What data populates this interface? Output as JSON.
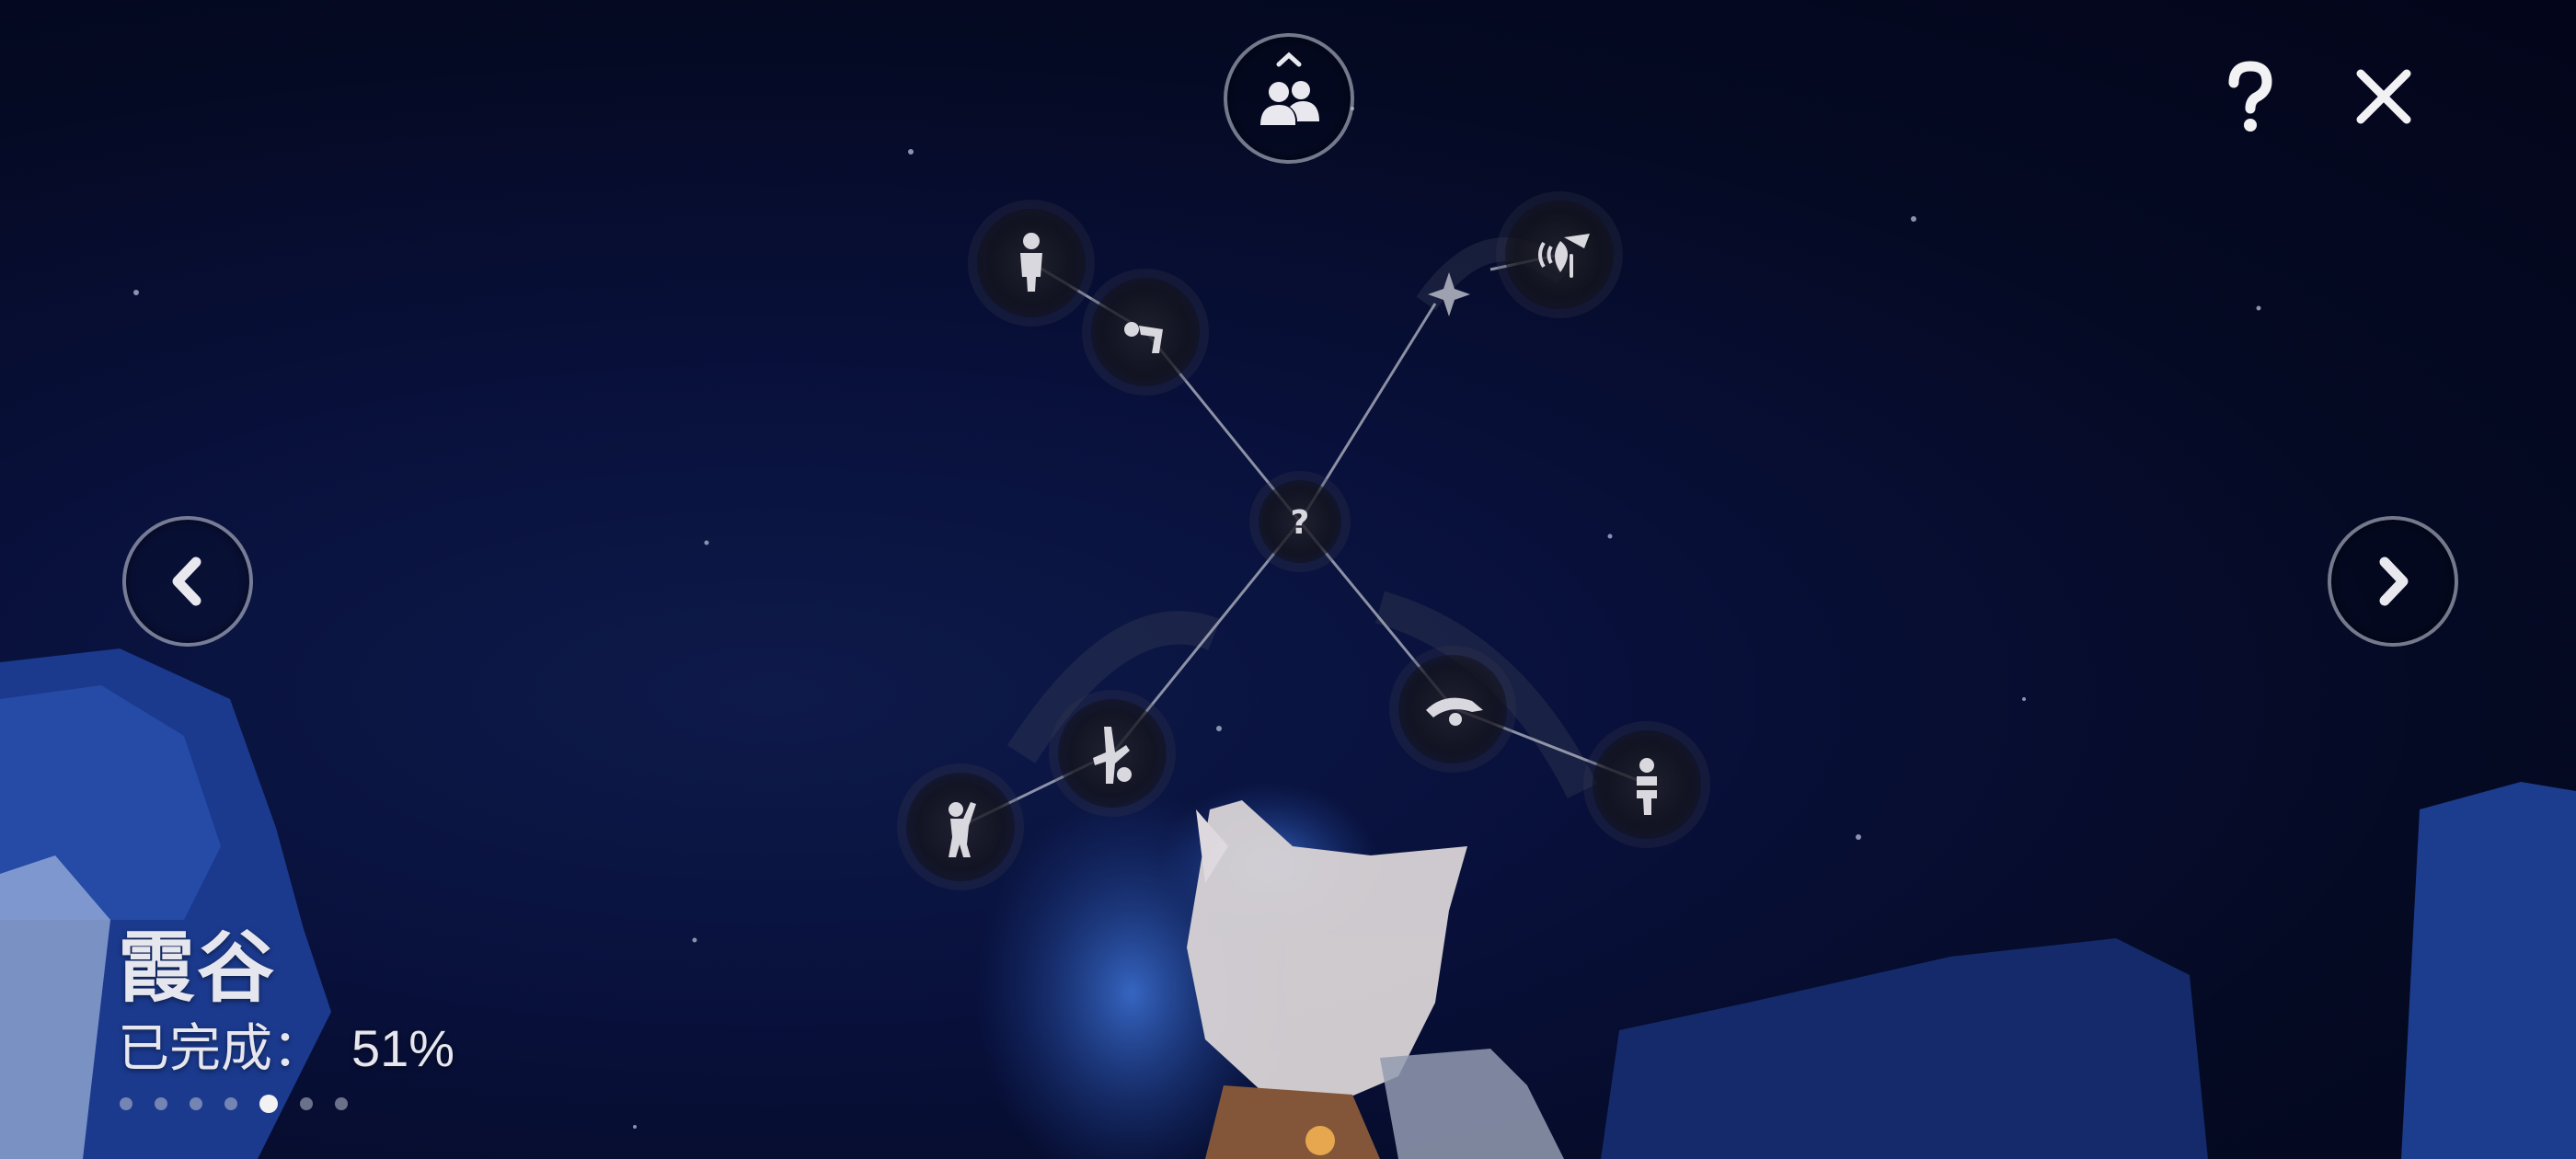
{
  "area": {
    "name": "霞谷",
    "progress_label": "已完成：",
    "progress_value": "51%",
    "progress_fraction": 0.51
  },
  "pagination": {
    "total": 7,
    "current_index": 4
  },
  "icons": {
    "friends": "friends-icon",
    "help": "question-mark-icon",
    "close": "close-icon",
    "prev": "chevron-left-icon",
    "next": "chevron-right-icon"
  },
  "constellation": {
    "center_symbol": "?",
    "center_state": "locked",
    "nodes": [
      "standing-emote-icon",
      "bow-emote-icon",
      "shush-emote-icon",
      "handstand-emote-icon",
      "wave-emote-icon",
      "dive-emote-icon",
      "crossed-arms-emote-icon"
    ]
  },
  "colors": {
    "line": "#b8bcc8",
    "node_icon": "#d8d8de",
    "button_border": "#c8ccd8"
  }
}
